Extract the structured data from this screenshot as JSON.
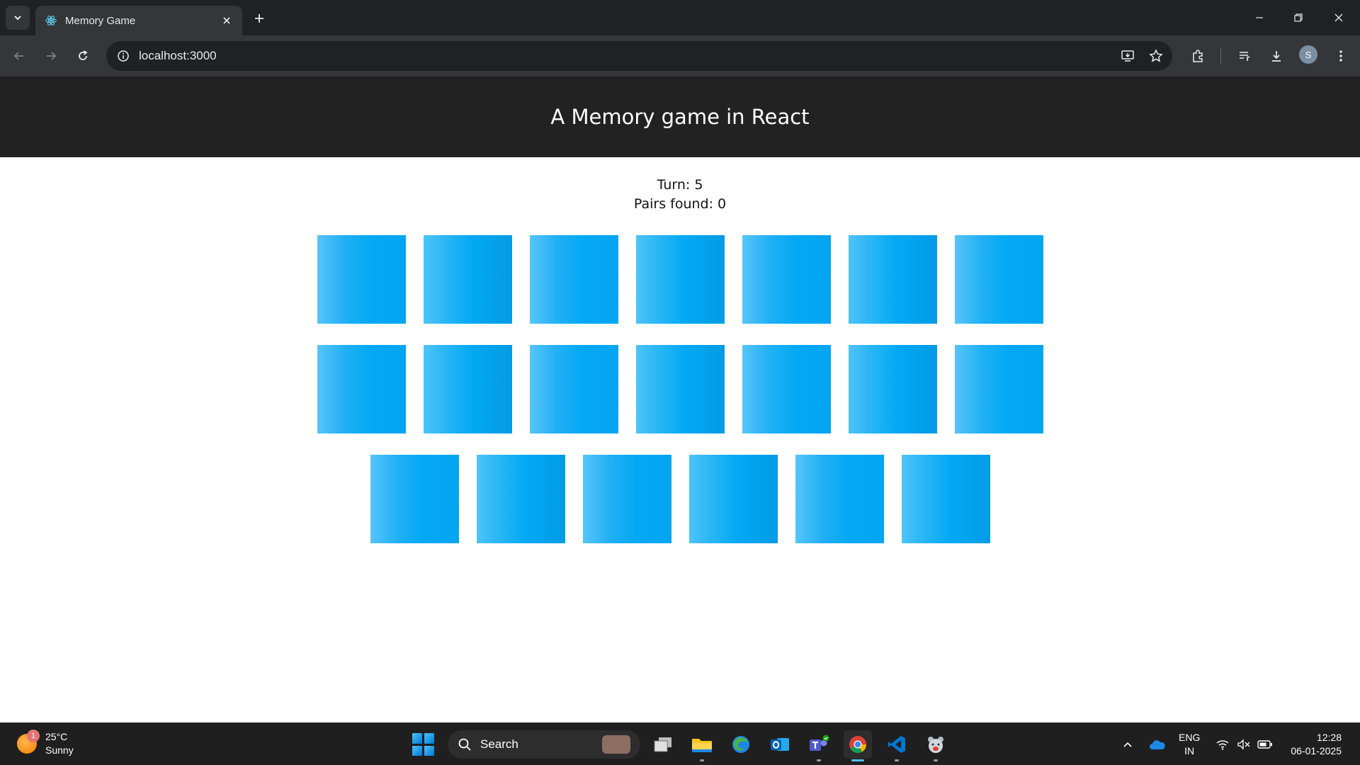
{
  "browser": {
    "tab_title": "Memory Game",
    "url": "localhost:3000",
    "profile_initial": "S"
  },
  "app": {
    "title": "A Memory game in React",
    "turn_text": "Turn: 5",
    "pairs_text": "Pairs found: 0",
    "card_rows": [
      7,
      7,
      6
    ],
    "card_color": "#03a9f4"
  },
  "taskbar": {
    "weather_badge": "1",
    "temperature": "25°C",
    "condition": "Sunny",
    "search_label": "Search",
    "lang_primary": "ENG",
    "lang_secondary": "IN",
    "time": "12:28",
    "date": "06-01-2025"
  }
}
